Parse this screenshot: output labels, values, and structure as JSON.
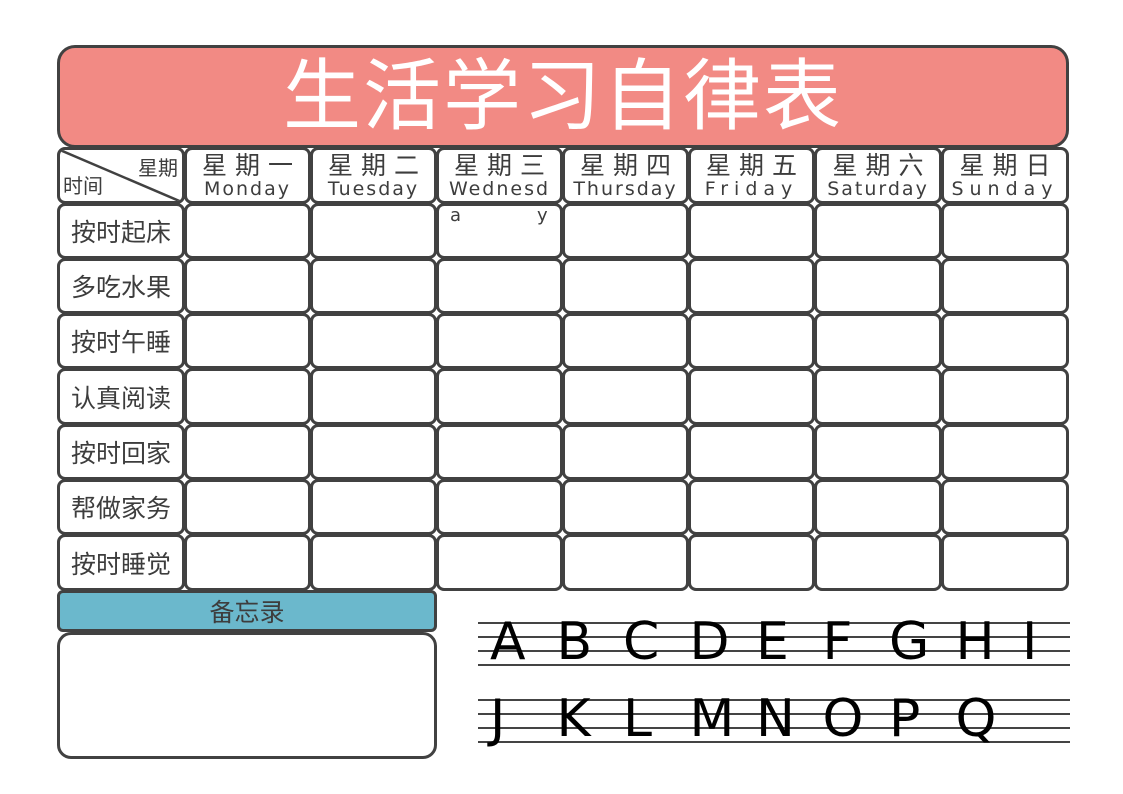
{
  "title": "生活学习自律表",
  "colors": {
    "title_bg": "#f28a84",
    "memo_header_bg": "#6bb8cc",
    "border": "#414141"
  },
  "corner": {
    "top_right": "星期",
    "bottom_left": "时间"
  },
  "days": [
    {
      "cn": "星期一",
      "en": "Monday"
    },
    {
      "cn": "星期二",
      "en": "Tuesday"
    },
    {
      "cn": "星期三",
      "en": "Wednesd"
    },
    {
      "cn": "星期四",
      "en": "Thursday"
    },
    {
      "cn": "星期五",
      "en": "Friday"
    },
    {
      "cn": "星期六",
      "en": "Saturday"
    },
    {
      "cn": "星期日",
      "en": "Sunday"
    }
  ],
  "wednesday_overflow": [
    "a",
    "y"
  ],
  "tasks": [
    "按时起床",
    "多吃水果",
    "按时午睡",
    "认真阅读",
    "按时回家",
    "帮做家务",
    "按时睡觉"
  ],
  "memo": {
    "header": "备忘录",
    "content": ""
  },
  "alphabet": {
    "row1": [
      "A",
      "B",
      "C",
      "D",
      "E",
      "F",
      "G",
      "H",
      "I"
    ],
    "row2": [
      "J",
      "K",
      "L",
      "M",
      "N",
      "O",
      "P",
      "Q"
    ]
  }
}
